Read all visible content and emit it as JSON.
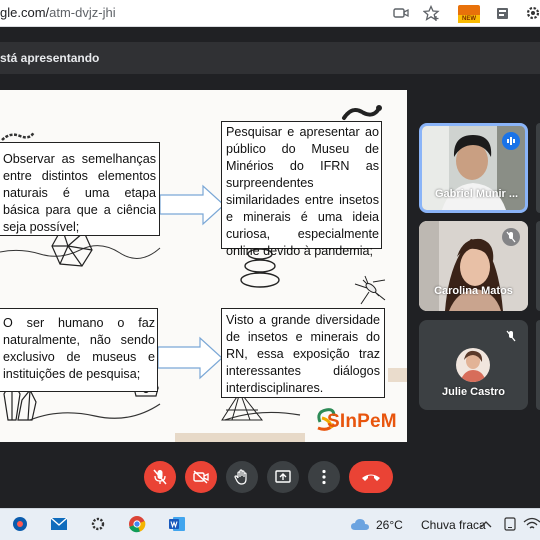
{
  "browser": {
    "url_host": "gle.com/",
    "url_path": "atm-dvjz-jhi",
    "new_badge": "NEW"
  },
  "meet": {
    "presenting_banner": "stá apresentando"
  },
  "slide": {
    "box1_text": "Observar as semelhanças entre distintos elementos naturais é uma etapa básica para que a ciência seja possível;",
    "box2_text": "Pesquisar e apresentar ao público do Museu de Minérios do IFRN as surpreendentes similaridades entre insetos e minerais é uma ideia curiosa, especialmente online devido à pandemia;",
    "box3_text": "O ser humano o faz naturalmente, não sendo exclusivo de museus e instituições de pesquisa;",
    "box4_text": "Visto a grande diversidade de insetos e minerais do RN, essa exposição traz interessantes diálogos interdisciplinares.",
    "logo_text": "SInPeM"
  },
  "participants": [
    {
      "name": "Gabriel Munir ...",
      "speaking": true
    },
    {
      "name": "Carolina Matos",
      "muted": true
    },
    {
      "name": "Julie Castro",
      "muted": true
    }
  ],
  "controls": [
    "mic-muted",
    "camera-off",
    "raise-hand",
    "present-screen",
    "more-options",
    "leave-call"
  ],
  "taskbar": {
    "temperature": "26°C",
    "weather": "Chuva fraca"
  },
  "colors": {
    "accent_red": "#ea4335",
    "meet_dark": "#202124",
    "speaking_border": "#8ab4f8",
    "logo_orange": "#e8550e"
  }
}
